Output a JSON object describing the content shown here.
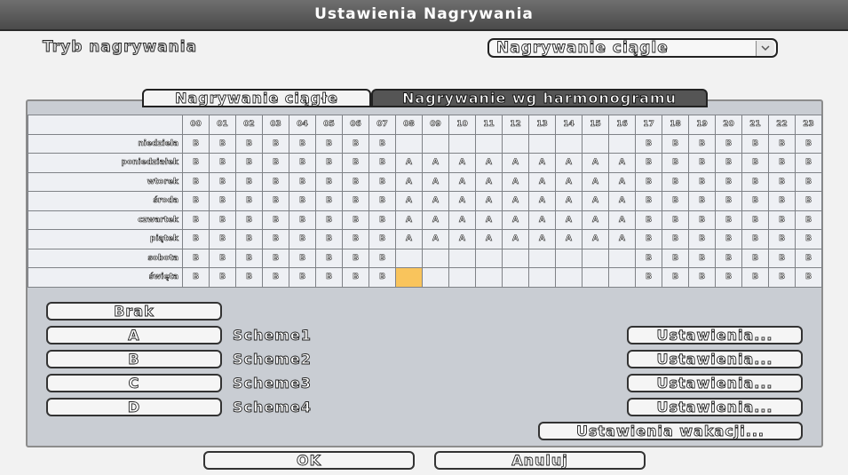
{
  "window": {
    "title": "Ustawienia Nagrywania"
  },
  "mode": {
    "label": "Tryb nagrywania",
    "selected": "Nagrywanie ciągle"
  },
  "tabs": [
    {
      "label": "Nagrywanie ciągłe"
    },
    {
      "label": "Nagrywanie wg harmonogramu"
    }
  ],
  "schedule": {
    "hours": [
      "00",
      "01",
      "02",
      "03",
      "04",
      "05",
      "06",
      "07",
      "08",
      "09",
      "10",
      "11",
      "12",
      "13",
      "14",
      "15",
      "16",
      "17",
      "18",
      "19",
      "20",
      "21",
      "22",
      "23"
    ],
    "rows": [
      {
        "day": "niedziela",
        "cells": [
          "B",
          "B",
          "B",
          "B",
          "B",
          "B",
          "B",
          "B",
          "",
          "",
          "",
          "",
          "",
          "",
          "",
          "",
          "",
          "B",
          "B",
          "B",
          "B",
          "B",
          "B",
          "B"
        ]
      },
      {
        "day": "poniedziałek",
        "cells": [
          "B",
          "B",
          "B",
          "B",
          "B",
          "B",
          "B",
          "B",
          "A",
          "A",
          "A",
          "A",
          "A",
          "A",
          "A",
          "A",
          "A",
          "B",
          "B",
          "B",
          "B",
          "B",
          "B",
          "B"
        ]
      },
      {
        "day": "wtorek",
        "cells": [
          "B",
          "B",
          "B",
          "B",
          "B",
          "B",
          "B",
          "B",
          "A",
          "A",
          "A",
          "A",
          "A",
          "A",
          "A",
          "A",
          "A",
          "B",
          "B",
          "B",
          "B",
          "B",
          "B",
          "B"
        ]
      },
      {
        "day": "środa",
        "cells": [
          "B",
          "B",
          "B",
          "B",
          "B",
          "B",
          "B",
          "B",
          "A",
          "A",
          "A",
          "A",
          "A",
          "A",
          "A",
          "A",
          "A",
          "B",
          "B",
          "B",
          "B",
          "B",
          "B",
          "B"
        ]
      },
      {
        "day": "czwartek",
        "cells": [
          "B",
          "B",
          "B",
          "B",
          "B",
          "B",
          "B",
          "B",
          "A",
          "A",
          "A",
          "A",
          "A",
          "A",
          "A",
          "A",
          "A",
          "B",
          "B",
          "B",
          "B",
          "B",
          "B",
          "B"
        ]
      },
      {
        "day": "piątek",
        "cells": [
          "B",
          "B",
          "B",
          "B",
          "B",
          "B",
          "B",
          "B",
          "A",
          "A",
          "A",
          "A",
          "A",
          "A",
          "A",
          "A",
          "A",
          "B",
          "B",
          "B",
          "B",
          "B",
          "B",
          "B"
        ]
      },
      {
        "day": "sobota",
        "cells": [
          "B",
          "B",
          "B",
          "B",
          "B",
          "B",
          "B",
          "B",
          "",
          "",
          "",
          "",
          "",
          "",
          "",
          "",
          "",
          "B",
          "B",
          "B",
          "B",
          "B",
          "B",
          "B"
        ]
      },
      {
        "day": "święta",
        "cells": [
          "B",
          "B",
          "B",
          "B",
          "B",
          "B",
          "B",
          "B",
          "",
          "",
          "",
          "",
          "",
          "",
          "",
          "",
          "",
          "B",
          "B",
          "B",
          "B",
          "B",
          "B",
          "B"
        ]
      }
    ],
    "selected_cell": {
      "row": "święta",
      "hour": "08"
    },
    "selected_color": "#f9c45c"
  },
  "schemes": {
    "none_label": "Brak",
    "items": [
      {
        "key": "A",
        "name": "Scheme1",
        "settings": "Ustawienia..."
      },
      {
        "key": "B",
        "name": "Scheme2",
        "settings": "Ustawienia..."
      },
      {
        "key": "C",
        "name": "Scheme3",
        "settings": "Ustawienia..."
      },
      {
        "key": "D",
        "name": "Scheme4",
        "settings": "Ustawienia..."
      }
    ],
    "holiday_settings": "Ustawienia wakacji..."
  },
  "footer": {
    "ok": "OK",
    "cancel": "Anuluj"
  },
  "icons": {
    "dropdown": "chevron-down-icon"
  }
}
